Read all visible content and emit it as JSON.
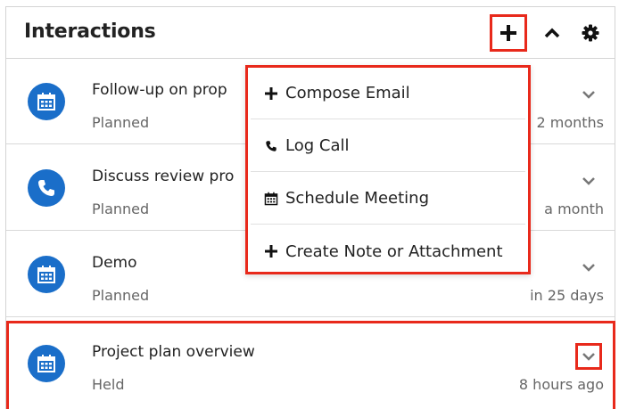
{
  "dashlet": {
    "title": "Interactions",
    "add_icon": "plus-icon",
    "collapse_icon": "chevron-up-icon",
    "settings_icon": "gear-icon"
  },
  "rows": [
    {
      "icon": "calendar-icon",
      "title": "Follow-up on prop",
      "status": "Planned",
      "time": "2 months"
    },
    {
      "icon": "phone-icon",
      "title": "Discuss review pro",
      "status": "Planned",
      "time": "a month"
    },
    {
      "icon": "calendar-icon",
      "title": "Demo",
      "status": "Planned",
      "time": "in 25 days"
    },
    {
      "icon": "calendar-icon",
      "title": "Project plan overview",
      "status": "Held",
      "time": "8 hours ago"
    }
  ],
  "menu": {
    "items": [
      {
        "icon": "plus-icon",
        "label": "Compose Email"
      },
      {
        "icon": "phone-icon",
        "label": "Log Call"
      },
      {
        "icon": "calendar-icon",
        "label": "Schedule Meeting"
      },
      {
        "icon": "plus-icon",
        "label": "Create Note or Attachment"
      }
    ]
  },
  "colors": {
    "accent": "#1a6ec9",
    "highlight": "#e8291b"
  }
}
